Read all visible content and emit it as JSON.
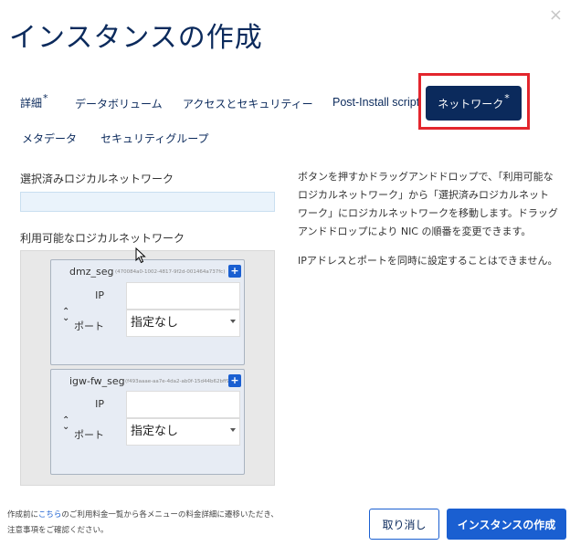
{
  "modal": {
    "title": "インスタンスの作成",
    "close_glyph": "×"
  },
  "tabs": [
    {
      "label": "詳細",
      "required": "*"
    },
    {
      "label": "データボリューム"
    },
    {
      "label": "アクセスとセキュリティー"
    },
    {
      "label": "Post-Install script"
    },
    {
      "label": "ネットワーク",
      "required": "*",
      "active": true
    },
    {
      "label": "メタデータ"
    },
    {
      "label": "セキュリティグループ"
    }
  ],
  "left": {
    "selected_label": "選択済みロジカルネットワーク",
    "available_label": "利用可能なロジカルネットワーク"
  },
  "networks": [
    {
      "name": "dmz_seg",
      "id": "(470084a0-1002-4817-9f2d-001464a737fc)",
      "add": "+",
      "ip_label": "IP",
      "port_label": "ポート",
      "port_value": "指定なし"
    },
    {
      "name": "igw-fw_seg",
      "id": "(f493aaae-aa7e-4da2-ab0f-15d44b62bff9)",
      "add": "+",
      "ip_label": "IP",
      "port_label": "ポート",
      "port_value": "指定なし"
    }
  ],
  "help": {
    "p1": "ボタンを押すかドラッグアンドドロップで、「利用可能なロジカルネットワーク」から「選択済みロジカルネットワーク」にロジカルネットワークを移動します。ドラッグアンドドロップにより NIC の順番を変更できます。",
    "p2": "IPアドレスとポートを同時に設定することはできません。"
  },
  "footer": {
    "note_before": "作成前に",
    "note_link": "こちら",
    "note_after": "のご利用料金一覧から各メニューの料金詳細に遷移いただき、",
    "note_line2": "注意事項をご確認ください。",
    "cancel_label": "取り消し",
    "create_label": "インスタンスの作成"
  },
  "colors": {
    "navy": "#0b2a5c",
    "accent_blue": "#1a5fd1",
    "highlight_red": "#e3262d"
  }
}
